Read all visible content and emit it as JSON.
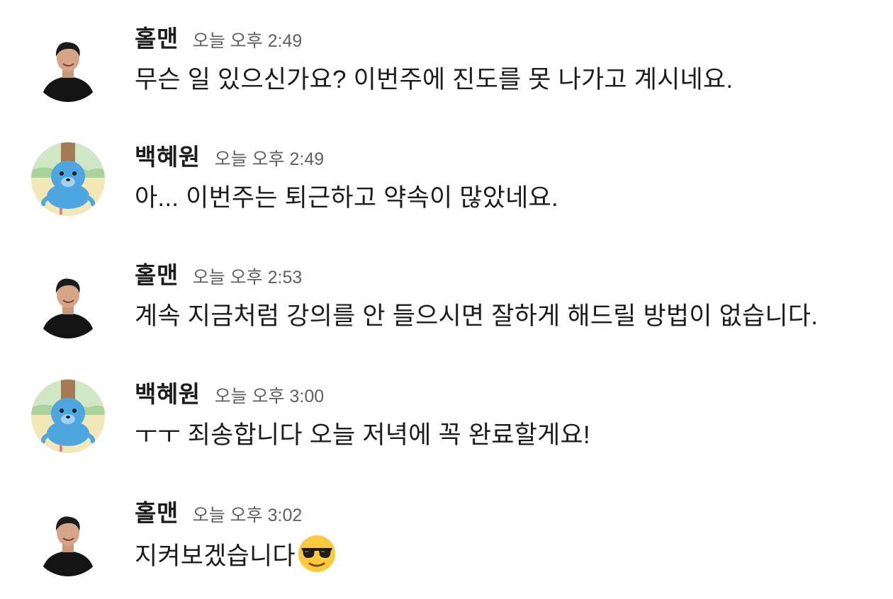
{
  "messages": [
    {
      "sender": "홀맨",
      "avatar_icon": "person-photo-avatar",
      "time": "오늘 오후 2:49",
      "text": "무슨 일 있으신가요? 이번주에 진도를 못 나가고 계시네요."
    },
    {
      "sender": "백혜원",
      "avatar_icon": "blue-mascot-avatar",
      "time": "오늘 오후 2:49",
      "text": "아... 이번주는 퇴근하고 약속이 많았네요."
    },
    {
      "sender": "홀맨",
      "avatar_icon": "person-photo-avatar",
      "time": "오늘 오후 2:53",
      "text": "계속 지금처럼 강의를 안 들으시면 잘하게 해드릴 방법이 없습니다."
    },
    {
      "sender": "백혜원",
      "avatar_icon": "blue-mascot-avatar",
      "time": "오늘 오후 3:00",
      "text": "ㅜㅜ 죄송합니다 오늘 저녁에 꼭 완료할게요!"
    },
    {
      "sender": "홀맨",
      "avatar_icon": "person-photo-avatar",
      "time": "오늘 오후 3:02",
      "text": "지켜보겠습니다",
      "emoji": "sunglasses-emoji"
    }
  ],
  "colors": {
    "sender": "#1d1c1d",
    "time": "#616061",
    "text": "#1d1c1d",
    "background": "#ffffff"
  }
}
